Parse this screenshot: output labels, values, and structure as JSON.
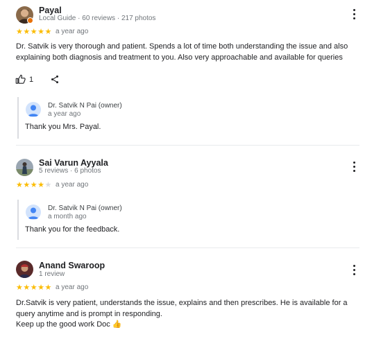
{
  "reviews": [
    {
      "name": "Payal",
      "meta": "Local Guide · 60 reviews · 217 photos",
      "rating": 5,
      "stars_on": "★★★★★",
      "stars_off": "",
      "time": "a year ago",
      "text": "Dr. Satvik is very thorough and patient. Spends a lot of time both understanding the issue and also explaining both diagnosis and treatment to you. Also very approachable and available for queries",
      "likes": "1",
      "reply": {
        "name": "Dr. Satvik N Pai (owner)",
        "time": "a year ago",
        "text": "Thank you Mrs. Payal."
      }
    },
    {
      "name": "Sai Varun Ayyala",
      "meta": "5 reviews · 6 photos",
      "rating": 4,
      "stars_on": "★★★★",
      "stars_off": "★",
      "time": "a year ago",
      "reply": {
        "name": "Dr. Satvik N Pai (owner)",
        "time": "a month ago",
        "text": "Thank you for the feedback."
      }
    },
    {
      "name": "Anand Swaroop",
      "meta": "1 review",
      "rating": 5,
      "stars_on": "★★★★★",
      "stars_off": "",
      "time": "a year ago",
      "text": "Dr.Satvik is very patient, understands the issue, explains and then prescribes. He is available for a query anytime and is prompt in responding.",
      "text2": "Keep up the good work Doc 👍"
    }
  ],
  "colors": {
    "star": "#fbbc04",
    "star_empty": "#dadce0",
    "meta": "#70757a",
    "divider": "#e8eaed"
  },
  "icons": {
    "more": "more-vert-icon",
    "like": "thumb-up-icon",
    "share": "share-icon",
    "owner_avatar": "person-icon"
  }
}
